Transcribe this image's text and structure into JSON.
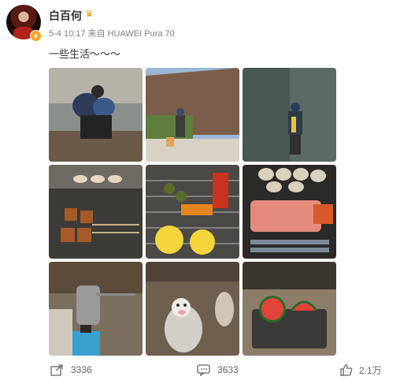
{
  "post": {
    "username": "白百何",
    "time": "5-4 10:17",
    "source": "来自 HUAWEI Pura 70",
    "text": "一些生活～～～"
  },
  "photos": [
    {
      "subject": "两人在河边弯腰"
    },
    {
      "subject": "戴帽子的人站在山坡前"
    },
    {
      "subject": "站在岩石旁的人"
    },
    {
      "subject": "烤架上的烤串和扇贝"
    },
    {
      "subject": "烧烤网上的蔬菜和柠檬"
    },
    {
      "subject": "海鲜拼盘"
    },
    {
      "subject": "露营卡式炉和水壶"
    },
    {
      "subject": "泥地上的玩偶"
    },
    {
      "subject": "桌上的西瓜片"
    }
  ],
  "actions": {
    "shares": "3336",
    "comments": "3633",
    "likes": "2.1万"
  },
  "colors": {
    "meta_gray": "#808080",
    "badge_orange": "#f5a623"
  }
}
